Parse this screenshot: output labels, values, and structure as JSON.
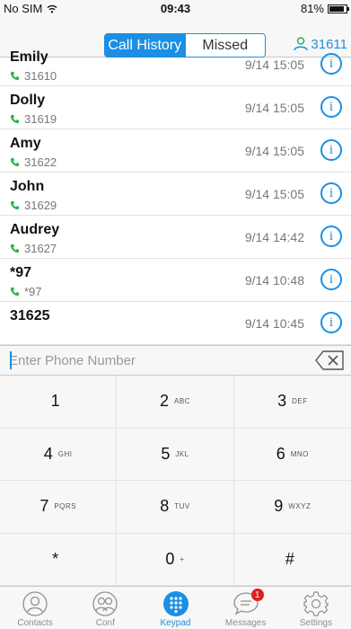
{
  "status_bar": {
    "carrier": "No SIM",
    "time": "09:43",
    "battery": "81%"
  },
  "header": {
    "tabs": [
      {
        "label": "Call History",
        "active": true
      },
      {
        "label": "Missed",
        "active": false
      }
    ],
    "account": "31611",
    "accent_color": "#1a8fe3"
  },
  "calls": [
    {
      "name": "Emily",
      "number": "31610",
      "time": "9/14 15:05"
    },
    {
      "name": "Dolly",
      "number": "31619",
      "time": "9/14 15:05"
    },
    {
      "name": "Amy",
      "number": "31622",
      "time": "9/14 15:05"
    },
    {
      "name": "John",
      "number": "31629",
      "time": "9/14 15:05"
    },
    {
      "name": "Audrey",
      "number": "31627",
      "time": "9/14 14:42"
    },
    {
      "name": "*97",
      "number": "*97",
      "time": "9/14 10:48"
    },
    {
      "name": "31625",
      "number": "",
      "time": "9/14 10:45"
    }
  ],
  "phone_input": {
    "placeholder": "Enter Phone Number",
    "value": ""
  },
  "keypad": [
    {
      "digit": "1",
      "letters": ""
    },
    {
      "digit": "2",
      "letters": "ABC"
    },
    {
      "digit": "3",
      "letters": "DEF"
    },
    {
      "digit": "4",
      "letters": "GHI"
    },
    {
      "digit": "5",
      "letters": "JKL"
    },
    {
      "digit": "6",
      "letters": "MNO"
    },
    {
      "digit": "7",
      "letters": "PQRS"
    },
    {
      "digit": "8",
      "letters": "TUV"
    },
    {
      "digit": "9",
      "letters": "WXYZ"
    },
    {
      "digit": "*",
      "letters": ""
    },
    {
      "digit": "0",
      "letters": "+"
    },
    {
      "digit": "#",
      "letters": ""
    }
  ],
  "tab_bar": [
    {
      "label": "Contacts",
      "icon": "contacts-icon",
      "active": false
    },
    {
      "label": "Conf",
      "icon": "conference-icon",
      "active": false
    },
    {
      "label": "Keypad",
      "icon": "keypad-icon",
      "active": true
    },
    {
      "label": "Messages",
      "icon": "messages-icon",
      "active": false,
      "badge": "1"
    },
    {
      "label": "Settings",
      "icon": "settings-icon",
      "active": false
    }
  ]
}
